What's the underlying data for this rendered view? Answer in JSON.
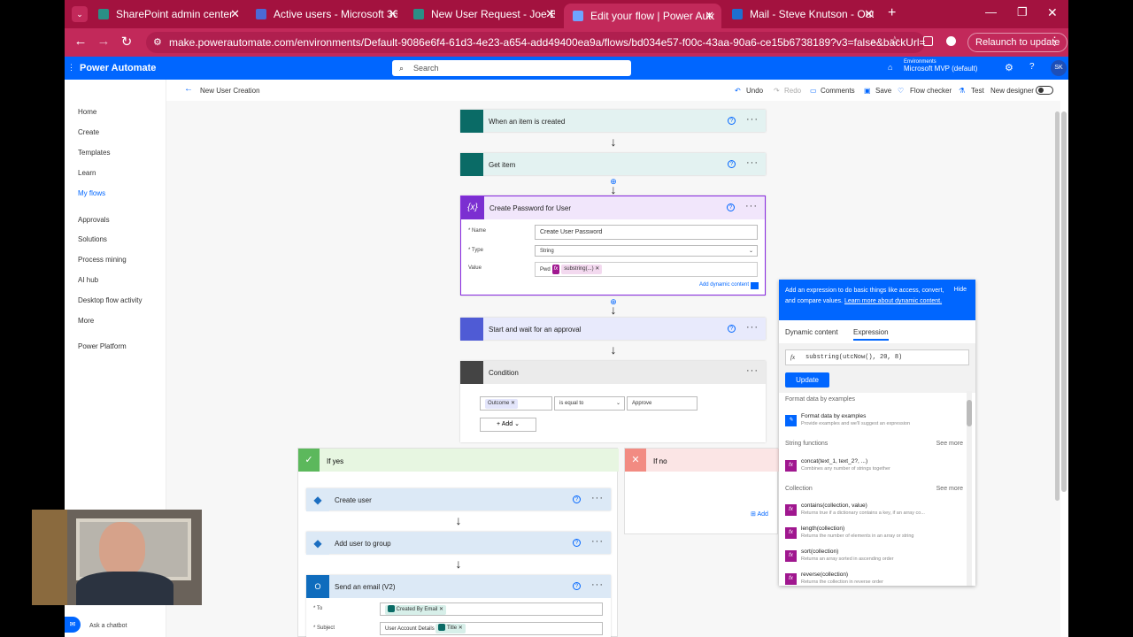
{
  "browser": {
    "tabs": [
      {
        "label": "SharePoint admin center",
        "color": "#2a8f86"
      },
      {
        "label": "Active users - Microsoft 365 ad",
        "color": "#4b6ad6"
      },
      {
        "label": "New User Request - Joe Bloggs",
        "color": "#2a8f86"
      },
      {
        "label": "Edit your flow | Power Automat",
        "color": "#2b6fe5",
        "active": true
      },
      {
        "label": "Mail - Steve Knutson - Outlook",
        "color": "#1e6fd0"
      }
    ],
    "url": "make.powerautomate.com/environments/Default-9086e6f4-61d3-4e23-a654-add49400ea9a/flows/bd034e57-f00c-43aa-90a6-ce15b6738189?v3=false&backUrl=%2Fe...",
    "relaunch_label": "Relaunch to update",
    "profile_initial": "⋮"
  },
  "header": {
    "app_name": "Power Automate",
    "search_placeholder": "Search",
    "env_label": "Environments",
    "env_name": "Microsoft MVP (default)",
    "avatar": "SK"
  },
  "leftnav": {
    "items": [
      "Home",
      "Create",
      "Templates",
      "Learn",
      "My flows",
      "Approvals",
      "Solutions",
      "Process mining",
      "AI hub",
      "Desktop flow activity",
      "More",
      "Power Platform"
    ],
    "chatbot": "Ask a chatbot"
  },
  "cmdbar": {
    "flow_name": "New User Creation",
    "undo": "Undo",
    "redo": "Redo",
    "comments": "Comments",
    "save": "Save",
    "flow_checker": "Flow checker",
    "test": "Test",
    "new_designer": "New designer"
  },
  "flow": {
    "trigger": "When an item is created",
    "get_item": "Get item",
    "create_pw": {
      "title": "Create Password for User",
      "name_label": "* Name",
      "name_value": "Create User Password",
      "type_label": "* Type",
      "type_value": "String",
      "value_label": "Value",
      "value_prefix": "Pwd",
      "value_token": "substring(...)",
      "add_dynamic": "Add dynamic content"
    },
    "approval": "Start and wait for an approval",
    "condition": {
      "title": "Condition",
      "left": "Outcome",
      "op": "is equal to",
      "right": "Approve",
      "add": "Add"
    },
    "if_yes": "If yes",
    "if_no": "If no",
    "add_action_partial": "Add",
    "create_user": "Create user",
    "add_to_group": "Add user to group",
    "send_email": {
      "title": "Send an email (V2)",
      "to_label": "* To",
      "to_token": "Created By Email",
      "subject_label": "* Subject",
      "subject_prefix": "User Account Details",
      "subject_token": "Title"
    }
  },
  "expression_panel": {
    "info": "Add an expression to do basic things like access, convert, and compare values.",
    "learn_more": "Learn more about dynamic content.",
    "hide": "Hide",
    "tab_dynamic": "Dynamic content",
    "tab_expression": "Expression",
    "expression": "substring(utcNow(), 20, 8)",
    "update": "Update",
    "sections": {
      "format": "Format data by examples",
      "string": "String functions",
      "collection": "Collection",
      "see_more": "See more"
    },
    "functions": [
      {
        "name": "Format data by examples",
        "desc": "Provide examples and we'll suggest an expression"
      },
      {
        "name": "concat(text_1, text_2?, ...)",
        "desc": "Combines any number of strings together"
      },
      {
        "name": "contains(collection, value)",
        "desc": "Returns true if a dictionary contains a key, if an array co..."
      },
      {
        "name": "length(collection)",
        "desc": "Returns the number of elements in an array or string"
      },
      {
        "name": "sort(collection)",
        "desc": "Returns an array sorted in ascending order"
      },
      {
        "name": "reverse(collection)",
        "desc": "Returns the collection in reverse order"
      }
    ]
  }
}
